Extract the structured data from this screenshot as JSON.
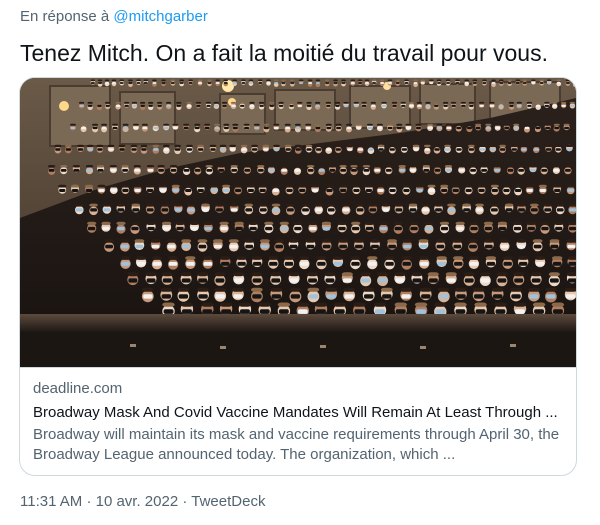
{
  "reply_context": {
    "prefix": "En réponse à",
    "mention": "@mitchgarber"
  },
  "tweet": {
    "text": "Tenez Mitch. On a fait la moitié du travail pour vous."
  },
  "link_card": {
    "image_subject": "theater-audience-photo",
    "domain": "deadline.com",
    "title": "Broadway Mask And Covid Vaccine Mandates Will Remain At Least Through ...",
    "description": "Broadway will maintain its mask and vaccine requirements through April 30, the Broadway League announced today. The organization, which ..."
  },
  "meta": {
    "time": "11:31 AM",
    "date": "10 avr. 2022",
    "source": "TweetDeck",
    "separator": "·"
  },
  "colors": {
    "secondary_text": "#536471",
    "link": "#1d9bf0",
    "primary_text": "#0f1419",
    "border": "#cfd9de"
  }
}
